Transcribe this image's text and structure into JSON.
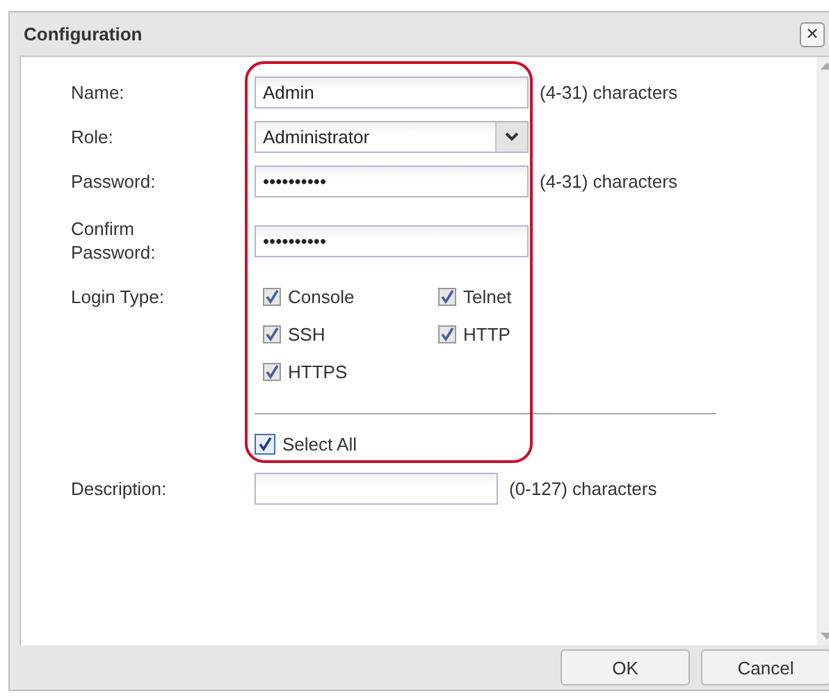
{
  "dialog": {
    "title": "Configuration",
    "close": "×"
  },
  "fields": [
    {
      "label": "Name:",
      "kind": "text",
      "value": "Admin",
      "hint": "(4-31) characters"
    },
    {
      "label": "Role:",
      "kind": "select",
      "value": "Administrator"
    },
    {
      "label": "Password:",
      "kind": "text",
      "value": "••••••••••",
      "hint": "(4-31) characters"
    },
    {
      "label": "Confirm Password:",
      "kind": "text",
      "value": "••••••••••"
    }
  ],
  "login_type": {
    "label": "Login Type:",
    "options": [
      {
        "label": "Console",
        "checked": true
      },
      {
        "label": "Telnet",
        "checked": true
      },
      {
        "label": "SSH",
        "checked": true
      },
      {
        "label": "HTTP",
        "checked": true
      },
      {
        "label": "HTTPS",
        "checked": true
      }
    ],
    "select_all": {
      "label": "Select All",
      "checked": true
    }
  },
  "description": {
    "label": "Description:",
    "hint": "(0-127) characters"
  },
  "buttons": [
    "OK",
    "Cancel"
  ]
}
